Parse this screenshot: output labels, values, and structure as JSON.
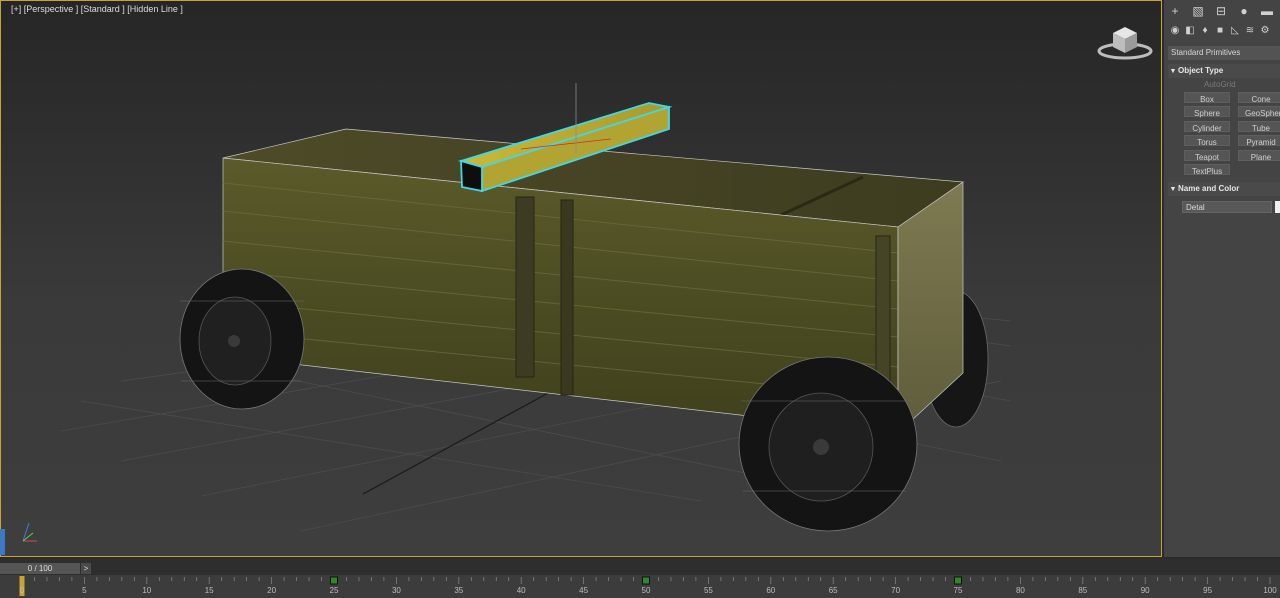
{
  "viewport": {
    "label": "[+] [Perspective ] [Standard ] [Hidden Line ]"
  },
  "command_panel": {
    "tabs": [
      "create-icon",
      "modify-icon",
      "hierarchy-icon",
      "motion-icon",
      "display-icon",
      "utilities-icon"
    ],
    "categories": [
      "geometry-icon",
      "shapes-icon",
      "lights-icon",
      "cameras-icon",
      "helpers-icon",
      "spacewarps-icon",
      "systems-icon"
    ],
    "dropdown": "Standard Primitives",
    "object_type_title": "Object Type",
    "autogrid": "AutoGrid",
    "primitives": [
      "Box",
      "Cone",
      "Sphere",
      "GeoSphere",
      "Cylinder",
      "Tube",
      "Torus",
      "Pyramid",
      "Teapot",
      "Plane",
      "TextPlus"
    ],
    "name_color_title": "Name and Color",
    "name_value": "Detal",
    "swatch_color": "#f0f0f0"
  },
  "timeline": {
    "frame_counter": "0 / 100",
    "next_label": ">",
    "ticks": [
      "0",
      "5",
      "10",
      "15",
      "20",
      "25",
      "30",
      "35",
      "40",
      "45",
      "50",
      "55",
      "60",
      "65",
      "70",
      "75",
      "80",
      "85",
      "90",
      "95",
      "100"
    ],
    "keyframes": [
      25,
      50,
      75
    ],
    "current_frame": 0,
    "total_frames": 100
  },
  "colors": {
    "selection": "#3fd8e8",
    "viewport_border": "#c8a532",
    "key": "#2a8a2a"
  }
}
